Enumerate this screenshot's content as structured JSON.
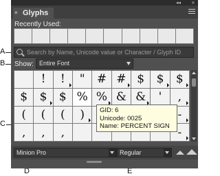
{
  "panel": {
    "tab_title": "Glyphs",
    "tab_close_glyph": "×",
    "collapse_glyph": "◂◂",
    "close_glyph": "×",
    "menu_icon": "panel-menu-icon"
  },
  "recent": {
    "label": "Recently Used:",
    "slots": 10
  },
  "search": {
    "placeholder": "Search by Name, Unicode value or Character / Glyph ID",
    "icon": "search-icon"
  },
  "show": {
    "label": "Show:",
    "value": "Entire Font"
  },
  "glyph_rows": [
    [
      {
        "g": "",
        "alt": false
      },
      {
        "g": "!",
        "alt": false
      },
      {
        "g": "!",
        "alt": true
      },
      {
        "g": "\"",
        "alt": false
      },
      {
        "g": "#",
        "alt": false
      },
      {
        "g": "#",
        "alt": true
      },
      {
        "g": "$",
        "alt": false
      },
      {
        "g": "$",
        "alt": true
      },
      {
        "g": "$",
        "alt": true
      }
    ],
    [
      {
        "g": "$",
        "alt": false
      },
      {
        "g": "$",
        "alt": true
      },
      {
        "g": "$",
        "alt": false
      },
      {
        "g": "%",
        "alt": false
      },
      {
        "g": "%",
        "alt": true
      },
      {
        "g": "&",
        "alt": false
      },
      {
        "g": "&",
        "alt": true
      },
      {
        "g": "'",
        "alt": false
      },
      {
        "g": ",",
        "alt": true
      }
    ],
    [
      {
        "g": "(",
        "alt": false
      },
      {
        "g": "(",
        "alt": false
      },
      {
        "g": "(",
        "alt": false
      },
      {
        "g": ")",
        "alt": true
      },
      {
        "g": "",
        "alt": false
      },
      {
        "g": "",
        "alt": false
      },
      {
        "g": "",
        "alt": false
      },
      {
        "g": "+",
        "alt": false
      },
      {
        "g": "-",
        "alt": true
      }
    ],
    [
      {
        "g": ",",
        "alt": false
      },
      {
        "g": ",",
        "alt": false
      },
      {
        "g": ",",
        "alt": false
      },
      {
        "g": "",
        "alt": false
      },
      {
        "g": "",
        "alt": false
      },
      {
        "g": "",
        "alt": false
      },
      {
        "g": "",
        "alt": false
      },
      {
        "g": "",
        "alt": false
      },
      {
        "g": "-",
        "alt": true
      }
    ]
  ],
  "tooltip": {
    "line1": "GID: 6",
    "line2": "Unicode: 0025",
    "line3": "Name: PERCENT SIGN"
  },
  "bottom": {
    "font_family": "Minion Pro",
    "font_style": "Regular"
  },
  "callouts": {
    "A": "A",
    "B": "B",
    "C": "C",
    "D": "D",
    "E": "E"
  }
}
